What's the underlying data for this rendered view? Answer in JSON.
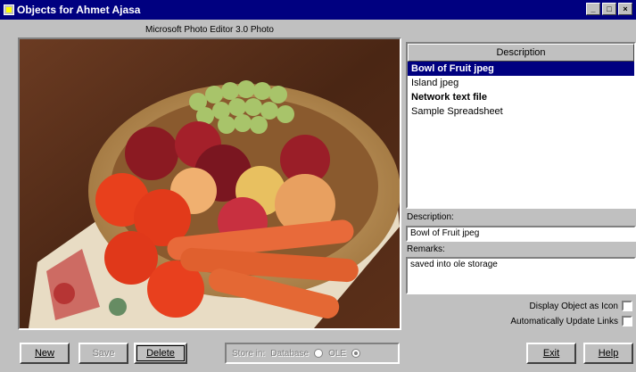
{
  "window": {
    "title": "Objects for Ahmet Ajasa",
    "minimize_icon": "minimize-icon",
    "maximize_icon": "maximize-icon",
    "close_icon": "close-icon"
  },
  "photo": {
    "caption": "Microsoft Photo Editor 3.0 Photo"
  },
  "list": {
    "header": "Description",
    "items": [
      {
        "label": "Bowl of Fruit jpeg",
        "selected": true,
        "bold": true
      },
      {
        "label": "Island jpeg",
        "selected": false,
        "bold": false
      },
      {
        "label": "Network text file",
        "selected": false,
        "bold": true
      },
      {
        "label": "Sample Spreadsheet",
        "selected": false,
        "bold": false
      }
    ]
  },
  "fields": {
    "description_label": "Description:",
    "description_value": "Bowl of Fruit jpeg",
    "remarks_label": "Remarks:",
    "remarks_value": "saved into ole storage"
  },
  "options": {
    "display_icon_label": "Display Object as Icon",
    "display_icon_checked": false,
    "auto_update_label": "Automatically Update Links",
    "auto_update_checked": false
  },
  "buttons": {
    "new": "New",
    "save": "Save",
    "delete": "Delete",
    "exit": "Exit",
    "help": "Help"
  },
  "store_in": {
    "label": "Store in:",
    "database_label": "Database",
    "ole_label": "OLE",
    "selected": "OLE"
  },
  "colors": {
    "title_bar": "#000080",
    "selection": "#000080",
    "face": "#c0c0c0"
  }
}
